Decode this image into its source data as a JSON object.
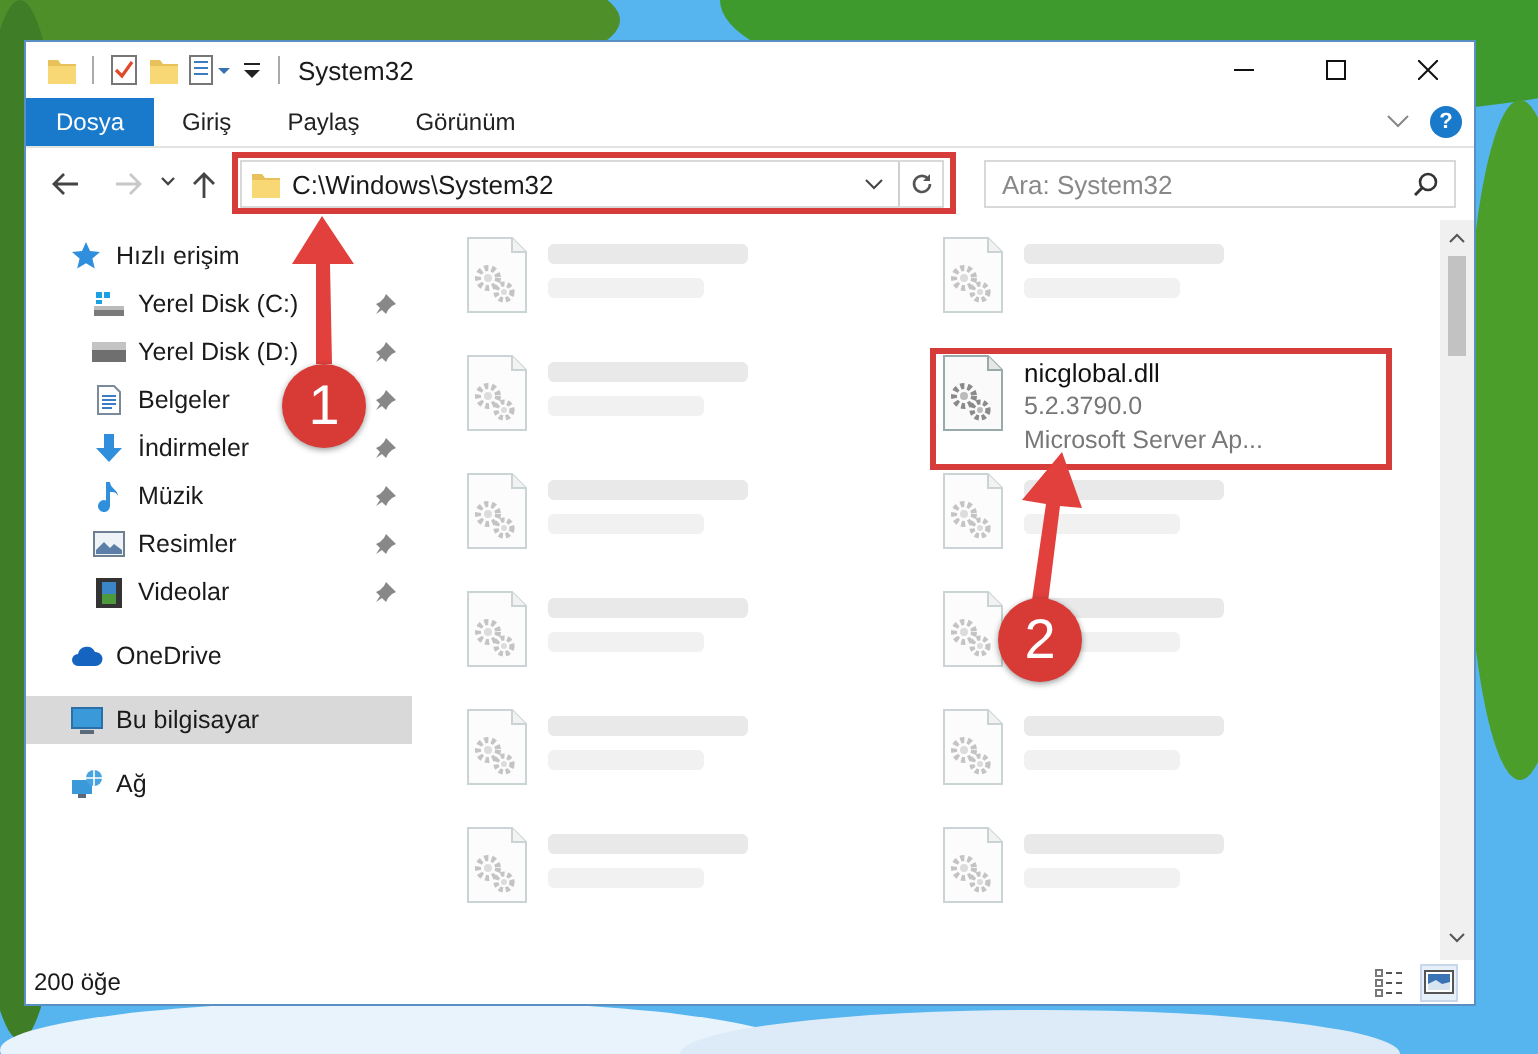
{
  "window": {
    "title": "System32"
  },
  "ribbon": {
    "tabs": [
      {
        "label": "Dosya",
        "selected": true
      },
      {
        "label": "Giriş",
        "selected": false
      },
      {
        "label": "Paylaş",
        "selected": false
      },
      {
        "label": "Görünüm",
        "selected": false
      }
    ],
    "help": "?"
  },
  "nav_buttons": [
    {
      "kind": "back",
      "disabled": false
    },
    {
      "kind": "forward",
      "disabled": true
    },
    {
      "kind": "recent",
      "disabled": false
    },
    {
      "kind": "up",
      "disabled": false
    }
  ],
  "address": {
    "value": "C:\\Windows\\System32"
  },
  "search": {
    "placeholder": "Ara: System32"
  },
  "sidebar": {
    "items": [
      {
        "label": "Hızlı erişim",
        "kind": "quick-access",
        "selected": false,
        "children": [
          {
            "label": "Yerel Disk (C:)",
            "kind": "system-drive",
            "selected": false,
            "pinned": true
          },
          {
            "label": "Yerel Disk (D:)",
            "kind": "drive",
            "selected": false,
            "pinned": true
          },
          {
            "label": "Belgeler",
            "kind": "documents",
            "selected": false,
            "pinned": true
          },
          {
            "label": "İndirmeler",
            "kind": "downloads",
            "selected": false,
            "pinned": true
          },
          {
            "label": "Müzik",
            "kind": "music",
            "selected": false,
            "pinned": true
          },
          {
            "label": "Resimler",
            "kind": "pictures",
            "selected": false,
            "pinned": true
          },
          {
            "label": "Videolar",
            "kind": "videos",
            "selected": false,
            "pinned": true
          }
        ]
      },
      {
        "label": "OneDrive",
        "kind": "cloud",
        "selected": false
      },
      {
        "label": "Bu bilgisayar",
        "kind": "computer",
        "selected": true
      },
      {
        "label": "Ağ",
        "kind": "network",
        "selected": false
      }
    ]
  },
  "files": [
    {
      "blurred": true
    },
    {
      "blurred": true
    },
    {
      "blurred": true
    },
    {
      "name": "nicglobal.dll",
      "details": [
        "5.2.3790.0",
        "Microsoft Server Ap..."
      ],
      "blurred": false
    },
    {
      "blurred": true
    },
    {
      "blurred": true
    },
    {
      "blurred": true
    },
    {
      "blurred": true
    },
    {
      "blurred": true
    },
    {
      "blurred": true
    },
    {
      "blurred": true
    },
    {
      "blurred": true
    }
  ],
  "status_bar": {
    "count": "200 öğe",
    "views": [
      {
        "kind": "details",
        "selected": false
      },
      {
        "kind": "tiles",
        "selected": true
      }
    ]
  },
  "annotations": [
    {
      "number": "1",
      "kind": "address"
    },
    {
      "number": "2",
      "kind": "file"
    }
  ]
}
